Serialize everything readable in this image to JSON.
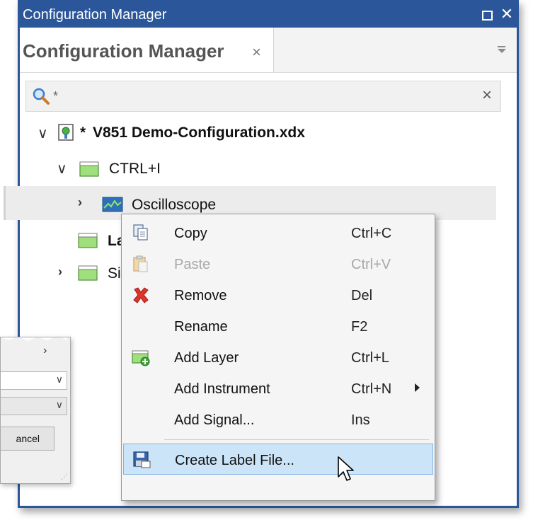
{
  "window": {
    "title": "Configuration Manager",
    "maximize_icon": "maximize-icon",
    "close_glyph": "✕",
    "accent": "#2b579a"
  },
  "tab": {
    "label": "Configuration Manager",
    "close_glyph": "×"
  },
  "search": {
    "value": "*",
    "clear_glyph": "×"
  },
  "tree": {
    "root": {
      "prefix": "* ",
      "label": "V851 Demo-Configuration.xdx",
      "expanded": true
    },
    "ctrl": {
      "label": "CTRL+I",
      "expanded": true
    },
    "oscilloscope": {
      "label": "Oscilloscope",
      "expanded": false
    },
    "layer_partial": {
      "label": "La"
    },
    "signal_partial": {
      "label": "Si"
    }
  },
  "background_dialog": {
    "button_label": "ancel"
  },
  "context_menu": {
    "items": [
      {
        "label": "Copy",
        "shortcut": "Ctrl+C",
        "icon": "copy-icon",
        "enabled": true
      },
      {
        "label": "Paste",
        "shortcut": "Ctrl+V",
        "icon": "paste-icon",
        "enabled": false
      },
      {
        "label": "Remove",
        "shortcut": "Del",
        "icon": "remove-icon",
        "enabled": true
      },
      {
        "label": "Rename",
        "shortcut": "F2",
        "icon": "",
        "enabled": true
      },
      {
        "label": "Add Layer",
        "shortcut": "Ctrl+L",
        "icon": "add-layer-icon",
        "enabled": true
      },
      {
        "label": "Add Instrument",
        "shortcut": "Ctrl+N",
        "icon": "",
        "enabled": true,
        "submenu": true
      },
      {
        "label": "Add Signal...",
        "shortcut": "Ins",
        "icon": "",
        "enabled": true
      },
      {
        "label": "Create Label File...",
        "shortcut": "",
        "icon": "save-label-icon",
        "enabled": true,
        "highlighted": true
      }
    ],
    "highlight_color": "#cce4f7"
  }
}
